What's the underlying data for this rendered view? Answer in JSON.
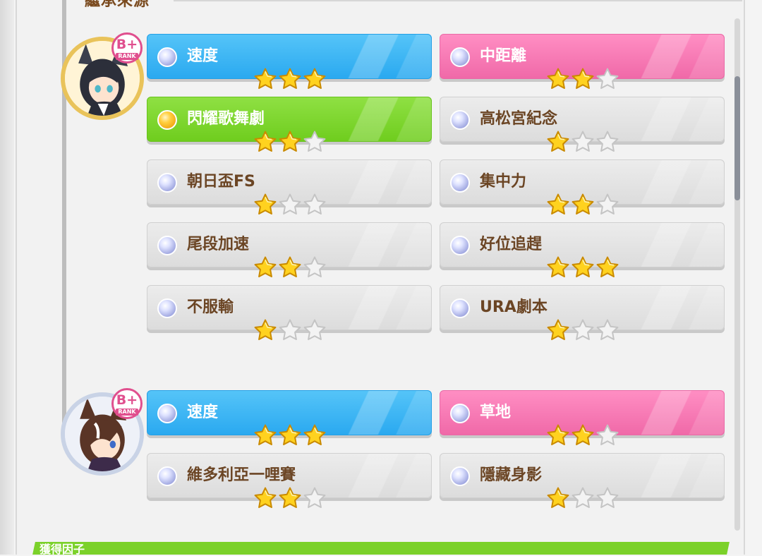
{
  "section": {
    "title": "繼承來源"
  },
  "footer": {
    "label": "獲得因子"
  },
  "parents": [
    {
      "rank": "B+",
      "rank_sub": "RANK",
      "avatar_icon": "character-portrait-icon",
      "factors": [
        {
          "label": "速度",
          "color": "blue",
          "orb": "silver",
          "stars": 3
        },
        {
          "label": "中距離",
          "color": "pink",
          "orb": "silver",
          "stars": 2
        },
        {
          "label": "閃耀歌舞劇",
          "color": "green",
          "orb": "gold",
          "stars": 2
        },
        {
          "label": "高松宮紀念",
          "color": "grey",
          "orb": "silver",
          "stars": 1
        },
        {
          "label": "朝日盃FS",
          "color": "grey",
          "orb": "silver",
          "stars": 1
        },
        {
          "label": "集中力",
          "color": "grey",
          "orb": "silver",
          "stars": 2
        },
        {
          "label": "尾段加速",
          "color": "grey",
          "orb": "silver",
          "stars": 2
        },
        {
          "label": "好位追趕",
          "color": "grey",
          "orb": "silver",
          "stars": 3
        },
        {
          "label": "不服輸",
          "color": "grey",
          "orb": "silver",
          "stars": 1
        },
        {
          "label": "URA劇本",
          "color": "grey",
          "orb": "silver",
          "stars": 1
        }
      ]
    },
    {
      "rank": "B+",
      "rank_sub": "RANK",
      "avatar_icon": "character-portrait-icon",
      "factors": [
        {
          "label": "速度",
          "color": "blue",
          "orb": "silver",
          "stars": 3
        },
        {
          "label": "草地",
          "color": "pink",
          "orb": "silver",
          "stars": 2
        },
        {
          "label": "維多利亞一哩賽",
          "color": "grey",
          "orb": "silver",
          "stars": 2
        },
        {
          "label": "隱藏身影",
          "color": "grey",
          "orb": "silver",
          "stars": 1
        }
      ]
    }
  ]
}
